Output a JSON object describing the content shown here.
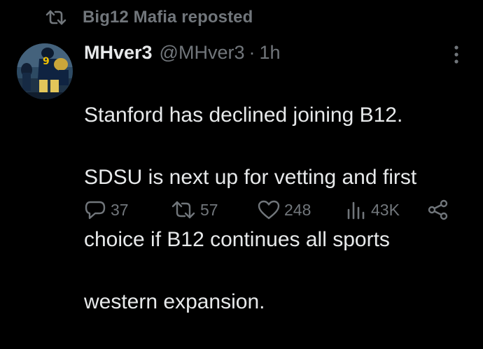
{
  "repost": {
    "icon": "repost-icon",
    "label": "Big12 Mafia reposted"
  },
  "author": {
    "avatar": "avatar-football-player-image",
    "name": "MHver3",
    "handle": "@MHver3",
    "separator": "·",
    "time": "1h"
  },
  "more_icon": "more-vertical-icon",
  "tweet": {
    "lines": [
      "Stanford has declined joining B12.",
      "SDSU is next up for vetting and first",
      "choice if B12 continues all sports",
      "western expansion."
    ]
  },
  "actions": {
    "reply": {
      "icon": "reply-icon",
      "count": "37"
    },
    "repost": {
      "icon": "repost-icon",
      "count": "57"
    },
    "like": {
      "icon": "heart-icon",
      "count": "248"
    },
    "views": {
      "icon": "views-icon",
      "count": "43K"
    },
    "share": {
      "icon": "share-icon"
    }
  },
  "colors": {
    "background": "#000000",
    "text": "#e7e9ea",
    "muted": "#71767b"
  }
}
